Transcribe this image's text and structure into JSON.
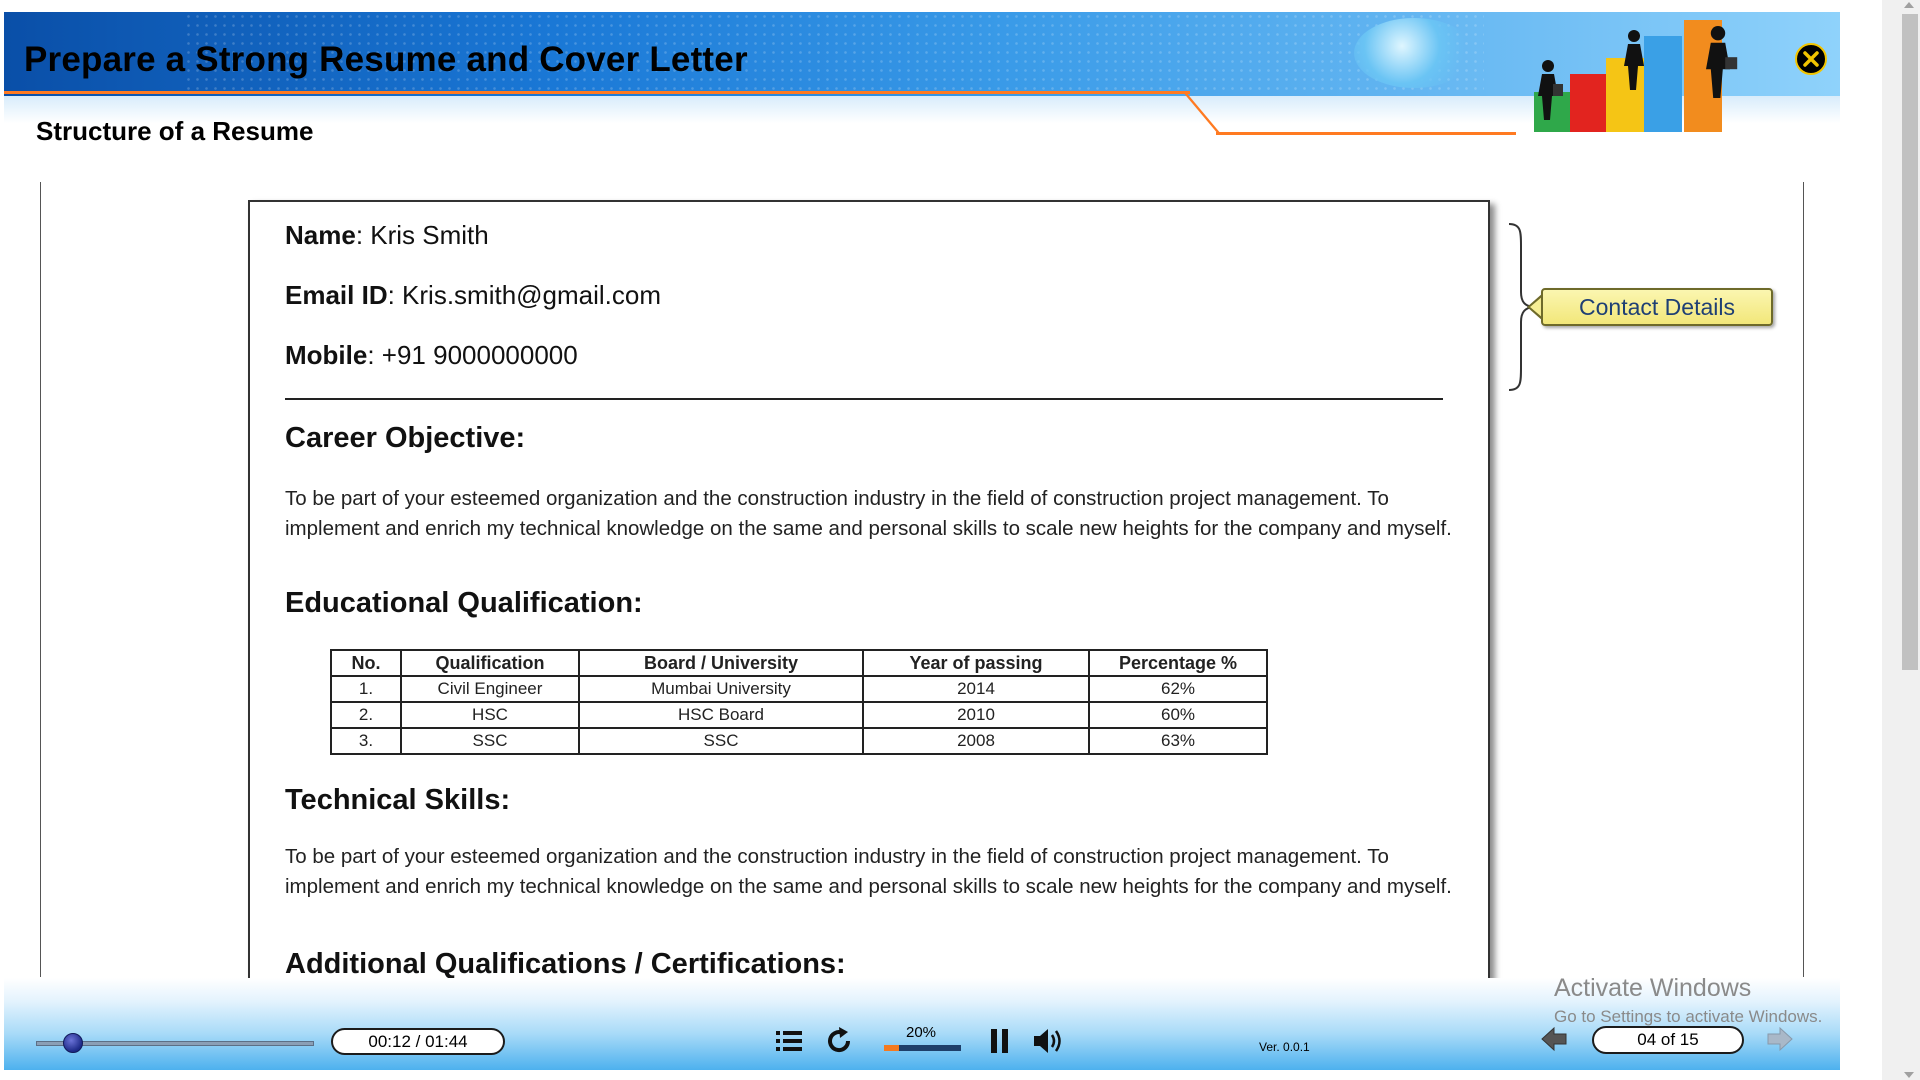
{
  "header": {
    "course_title": "Prepare a Strong Resume and Cover Letter",
    "section_title": "Structure of a Resume"
  },
  "resume": {
    "name_label": "Name",
    "name_value": ": Kris Smith",
    "email_label": "Email ID",
    "email_value": ": Kris.smith@gmail.com",
    "mobile_label": "Mobile",
    "mobile_value": ": +91 9000000000",
    "career_heading": "Career Objective:",
    "career_text": "To be part of your esteemed organization and the construction industry in the field of construction project management. To implement and enrich my technical knowledge on the same and personal skills to scale new heights for the company and myself.",
    "education_heading": "Educational Qualification:",
    "education_table": {
      "headers": [
        "No.",
        "Qualification",
        "Board / University",
        "Year of passing",
        "Percentage %"
      ],
      "rows": [
        [
          "1.",
          "Civil Engineer",
          "Mumbai University",
          "2014",
          "62%"
        ],
        [
          "2.",
          "HSC",
          "HSC Board",
          "2010",
          "60%"
        ],
        [
          "3.",
          "SSC",
          "SSC",
          "2008",
          "63%"
        ]
      ]
    },
    "skills_heading": "Technical Skills:",
    "skills_text": "To be part of your esteemed organization and the construction industry in the field of construction project management. To implement and enrich my technical knowledge on the same and personal skills to scale new heights for the company and myself.",
    "additional_heading": "Additional Qualifications / Certifications:"
  },
  "callout": {
    "label": "Contact Details"
  },
  "player": {
    "time": "00:12 / 01:44",
    "seek_progress": 0.12,
    "volume_label": "20%",
    "volume_level": 0.2,
    "version": "Ver. 0.0.1",
    "page_indicator": "04 of 15",
    "icons": [
      "menu-icon",
      "replay-icon",
      "pause-icon",
      "speaker-icon",
      "previous-arrow-icon",
      "next-arrow-icon",
      "close-icon"
    ]
  },
  "watermark": {
    "title": "Activate Windows",
    "subtitle": "Go to Settings to activate Windows."
  },
  "colors": {
    "banner_blue": "#1a78d6",
    "accent_orange": "#ff7a21",
    "callout_yellow": "#f2e77a",
    "callout_text": "#1e3f74"
  }
}
